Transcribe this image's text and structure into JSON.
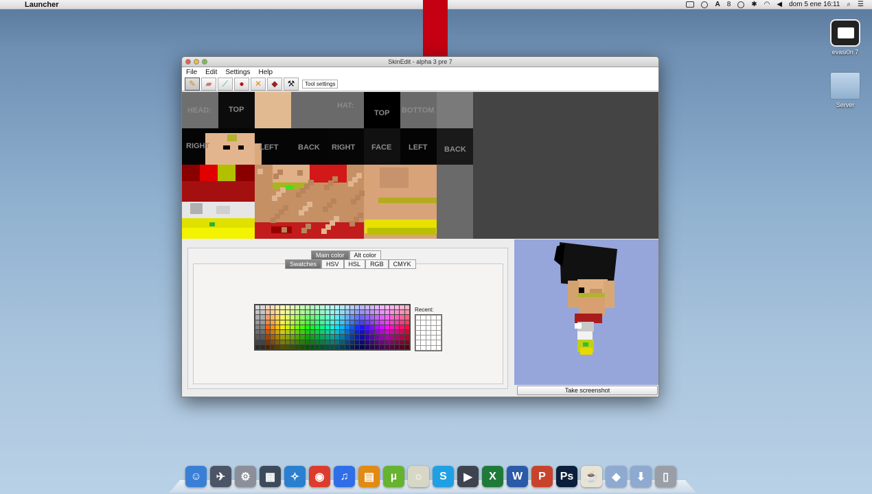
{
  "menubar": {
    "app_name": "Launcher",
    "clock": "dom 5 ene  16:11",
    "tray_label": "8"
  },
  "desktop_icons": [
    {
      "label": "evasi0n 7",
      "icon": "evasi0n-app-icon"
    },
    {
      "label": "Server",
      "icon": "folder-icon"
    }
  ],
  "window": {
    "title": "SkinEdit - alpha 3 pre 7",
    "menus": [
      "File",
      "Edit",
      "Settings",
      "Help"
    ],
    "tools": [
      "pencil-icon",
      "eraser-icon",
      "eyedropper-icon",
      "bucket-icon",
      "cross-tool-icon",
      "brush-icon",
      "hammer-icon"
    ],
    "tool_settings_label": "Tool settings",
    "skin_labels": {
      "head": "HEAD:",
      "hat": "HAT:",
      "top1": "TOP",
      "top2": "TOP",
      "bottom": "BOTTOM",
      "right1": "RIGHT",
      "left1": "LEFT",
      "back1": "BACK",
      "right2": "RIGHT",
      "face": "FACE",
      "left2": "LEFT",
      "back2": "BACK"
    },
    "color_tabs": [
      "Main color",
      "Alt color"
    ],
    "picker_tabs": [
      "Swatches",
      "HSV",
      "HSL",
      "RGB",
      "CMYK"
    ],
    "recent_label": "Recent:",
    "screenshot_button": "Take screenshot"
  },
  "dock": {
    "items": [
      "finder-icon",
      "launchpad-icon",
      "system-preferences-icon",
      "photo-booth-icon",
      "safari-icon",
      "chrome-icon",
      "itunes-icon",
      "ibooks-icon",
      "utorrent-icon",
      "preview-icon",
      "skype-icon",
      "imovie-icon",
      "excel-icon",
      "word-icon",
      "powerpoint-icon",
      "photoshop-icon",
      "java-icon",
      "applications-folder-icon",
      "downloads-folder-icon",
      "trash-icon"
    ],
    "colors": {
      "finder": "#3a7fd6",
      "chrome": "#dc3c2d",
      "utorrent": "#65b32e",
      "skype": "#1fa0e4",
      "excel": "#1f7a3a",
      "word": "#2a5aa8",
      "powerpoint": "#c8432b",
      "photoshop": "#0a1f3c"
    }
  }
}
